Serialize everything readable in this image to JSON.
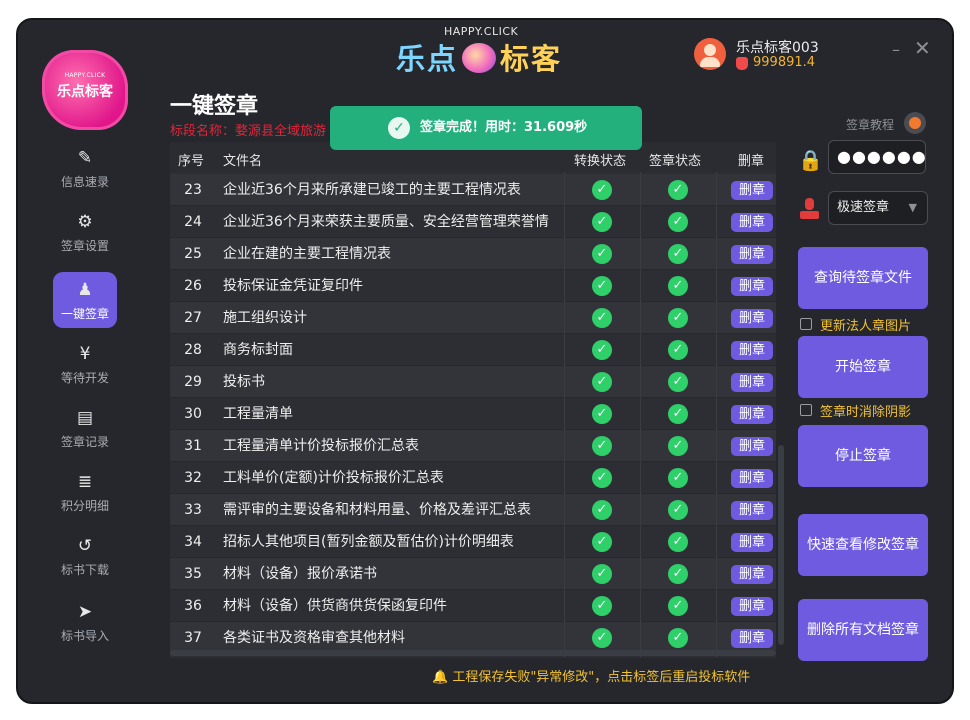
{
  "header": {
    "logo_small": "HAPPY.CLICK",
    "logo_text": "乐点标客",
    "brand_small": "HAPPY.CLICK",
    "brand_left": "乐点",
    "brand_right": "标客",
    "username": "乐点标客003",
    "points": "999891.4",
    "minimize": "–",
    "close": "✕"
  },
  "sidebar": {
    "items": [
      {
        "label": "信息速录",
        "icon": "edit-icon",
        "glyph": "✎",
        "active": false
      },
      {
        "label": "签章设置",
        "icon": "gear-icon",
        "glyph": "⚙",
        "active": false
      },
      {
        "label": "一键签章",
        "icon": "user-stamp-icon",
        "glyph": "♟",
        "active": true
      },
      {
        "label": "等待开发",
        "icon": "yen-icon",
        "glyph": "¥",
        "active": false
      },
      {
        "label": "签章记录",
        "icon": "record-icon",
        "glyph": "▤",
        "active": false
      },
      {
        "label": "积分明细",
        "icon": "database-icon",
        "glyph": "≣",
        "active": false
      },
      {
        "label": "标书下载",
        "icon": "history-icon",
        "glyph": "↺",
        "active": false
      },
      {
        "label": "标书导入",
        "icon": "send-icon",
        "glyph": "➤",
        "active": false
      }
    ]
  },
  "main": {
    "title": "一键签章",
    "subtitle": "标段名称：婺源县全域旅游",
    "toast": "签章完成！用时：31.609秒",
    "columns": [
      "序号",
      "文件名",
      "转换状态",
      "签章状态",
      "删章"
    ],
    "delete_label": "删章",
    "rows": [
      {
        "no": "23",
        "name": "企业近36个月来所承建已竣工的主要工程情况表"
      },
      {
        "no": "24",
        "name": "企业近36个月来荣获主要质量、安全经营管理荣誉情"
      },
      {
        "no": "25",
        "name": "企业在建的主要工程情况表"
      },
      {
        "no": "26",
        "name": "投标保证金凭证复印件"
      },
      {
        "no": "27",
        "name": "施工组织设计"
      },
      {
        "no": "28",
        "name": "商务标封面"
      },
      {
        "no": "29",
        "name": "投标书"
      },
      {
        "no": "30",
        "name": "工程量清单"
      },
      {
        "no": "31",
        "name": "工程量清单计价投标报价汇总表"
      },
      {
        "no": "32",
        "name": "工料单价(定额)计价投标报价汇总表"
      },
      {
        "no": "33",
        "name": "需评审的主要设备和材料用量、价格及差评汇总表"
      },
      {
        "no": "34",
        "name": "招标人其他项目(暂列金额及暂估价)计价明细表"
      },
      {
        "no": "35",
        "name": "材料（设备）报价承诺书"
      },
      {
        "no": "36",
        "name": "材料（设备）供货商供货保函复印件"
      },
      {
        "no": "37",
        "name": "各类证书及资格审查其他材料"
      }
    ]
  },
  "right": {
    "tutorial": "签章教程",
    "password": "●●●●●●",
    "select_value": "极速签章",
    "query_btn": "查询待签章文件",
    "update_chk": "更新法人章图片",
    "start_btn": "开始签章",
    "shadow_chk": "签章时消除阴影",
    "stop_btn": "停止签章",
    "quick_btn": "快速查看修改签章",
    "delete_all_btn": "删除所有文档签章"
  },
  "footer": {
    "notice": "🔔 工程保存失败\"异常修改\"，点击标签后重启投标软件"
  },
  "colors": {
    "accent": "#6f5be0",
    "success": "#2fd06a",
    "toast": "#23b07d",
    "warning": "#f2c232",
    "danger": "#e0263a"
  }
}
